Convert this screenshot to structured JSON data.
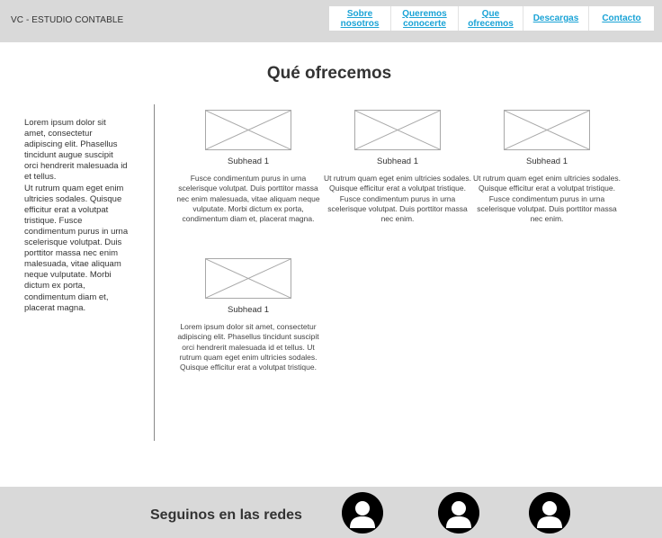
{
  "header": {
    "brand": "VC - ESTUDIO CONTABLE",
    "nav": [
      {
        "line1": "Sobre",
        "line2": "nosotros"
      },
      {
        "line1": "Queremos",
        "line2": "conocerte"
      },
      {
        "line1": "Que",
        "line2": "ofrecemos"
      },
      {
        "line1": "Descargas",
        "line2": ""
      },
      {
        "line1": "Contacto",
        "line2": ""
      }
    ]
  },
  "main": {
    "title": "Qué ofrecemos",
    "sidebar_text": "Lorem ipsum dolor sit amet, consectetur adipiscing elit. Phasellus tincidunt augue suscipit orci hendrerit malesuada id et tellus.\nUt rutrum quam eget enim ultricies sodales. Quisque efficitur erat a volutpat tristique. Fusce condimentum purus in urna scelerisque volutpat. Duis porttitor massa nec enim malesuada, vitae aliquam neque vulputate. Morbi dictum ex porta, condimentum diam et, placerat magna.",
    "cards": [
      {
        "subhead": "Subhead 1",
        "body": "Fusce condimentum purus in urna scelerisque volutpat. Duis porttitor massa nec enim malesuada, vitae aliquam neque vulputate. Morbi dictum ex porta, condimentum diam et, placerat magna."
      },
      {
        "subhead": "Subhead 1",
        "body": "Ut rutrum quam eget enim ultricies sodales. Quisque efficitur erat a volutpat tristique. Fusce condimentum purus in urna scelerisque volutpat. Duis porttitor massa nec enim."
      },
      {
        "subhead": "Subhead 1",
        "body": "Ut rutrum quam eget enim ultricies sodales. Quisque efficitur erat a volutpat tristique. Fusce condimentum purus in urna scelerisque volutpat. Duis porttitor massa nec enim."
      },
      {
        "subhead": "Subhead 1",
        "body": "Lorem ipsum dolor sit amet, consectetur adipiscing elit. Phasellus tincidunt suscipit orci hendrerit malesuada id et tellus. Ut rutrum quam eget enim ultricies sodales. Quisque efficitur erat a volutpat tristique."
      }
    ]
  },
  "footer": {
    "title": "Seguinos en las redes",
    "social_icons": [
      "user-avatar-icon",
      "user-avatar-icon",
      "user-avatar-icon"
    ]
  },
  "colors": {
    "header_bg": "#d9d9d9",
    "link": "#1aa3d6",
    "text": "#333333"
  }
}
